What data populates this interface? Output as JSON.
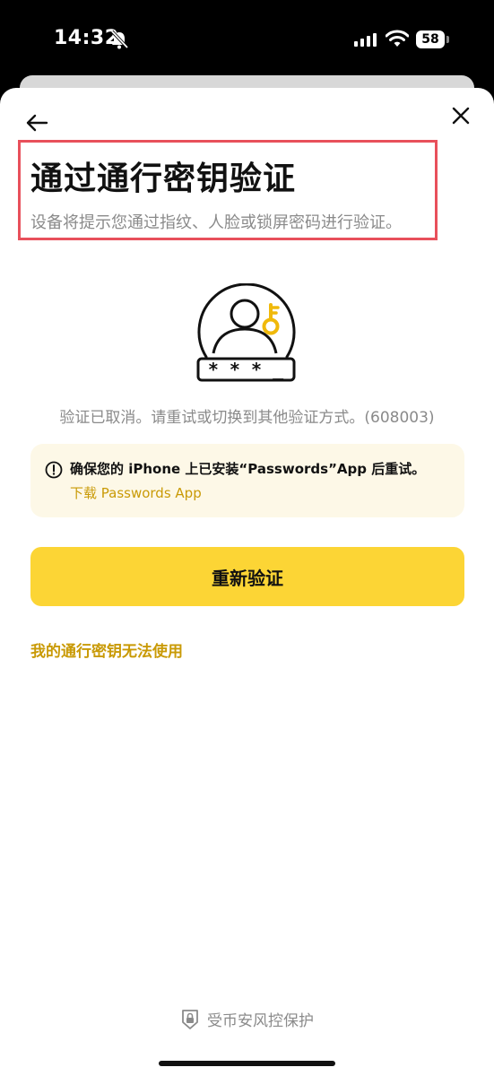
{
  "status_bar": {
    "time": "14:32",
    "battery": "58",
    "icons": [
      "bell-slash-icon",
      "signal-icon",
      "wifi-icon",
      "battery-icon"
    ]
  },
  "header": {
    "back_icon": "arrow-left-icon",
    "close_icon": "close-icon",
    "title": "通过通行密钥验证",
    "subtitle": "设备将提示您通过指纹、人脸或锁屏密码进行验证。"
  },
  "illustration": {
    "icon": "passkey-user-key-icon",
    "password_mask": "* * * _"
  },
  "error": {
    "message": "验证已取消。请重试或切换到其他验证方式。(608003)"
  },
  "notice": {
    "icon": "info-icon",
    "text": "确保您的 iPhone 上已安装“Passwords”App 后重试。",
    "link": "下载 Passwords App"
  },
  "actions": {
    "retry_label": "重新验证",
    "help_link": "我的通行密钥无法使用"
  },
  "footer": {
    "icon": "shield-lock-icon",
    "text": "受币安风控保护"
  },
  "colors": {
    "accent": "#fcd535",
    "link": "#c99a06",
    "notice_bg": "#fdf8e7",
    "highlight": "#e8505b"
  }
}
